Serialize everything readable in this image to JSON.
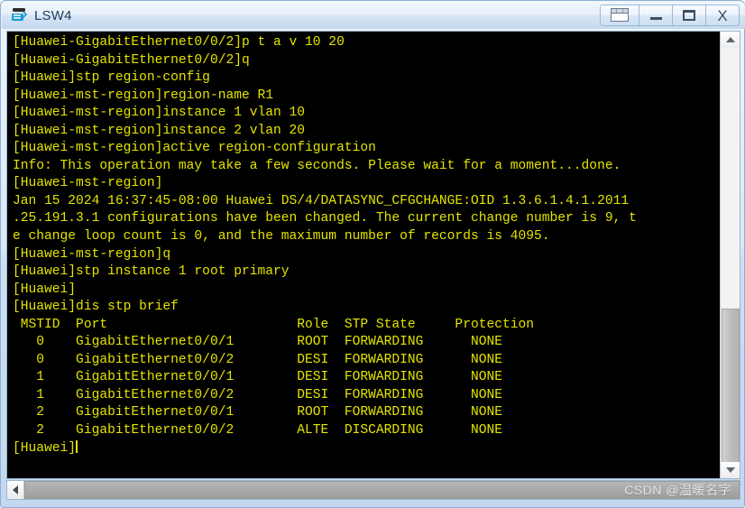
{
  "window": {
    "title": "LSW4",
    "app_icon": "switch-icon",
    "buttons": [
      {
        "name": "restore-all-button",
        "icon": "cascade-windows-icon",
        "label": ""
      },
      {
        "name": "minimize-button",
        "icon": "minimize-icon",
        "label": ""
      },
      {
        "name": "maximize-button",
        "icon": "maximize-icon",
        "label": ""
      },
      {
        "name": "close-button",
        "icon": "close-icon",
        "label": "X"
      }
    ]
  },
  "terminal": {
    "fg_color": "#e4e400",
    "bg_color": "#000000",
    "lines": [
      "[Huawei-GigabitEthernet0/0/2]p t a v 10 20",
      "[Huawei-GigabitEthernet0/0/2]q",
      "[Huawei]stp region-config",
      "[Huawei-mst-region]region-name R1",
      "[Huawei-mst-region]instance 1 vlan 10",
      "[Huawei-mst-region]instance 2 vlan 20",
      "[Huawei-mst-region]active region-configuration",
      "Info: This operation may take a few seconds. Please wait for a moment...done.",
      "[Huawei-mst-region]",
      "Jan 15 2024 16:37:45-08:00 Huawei DS/4/DATASYNC_CFGCHANGE:OID 1.3.6.1.4.1.2011",
      ".25.191.3.1 configurations have been changed. The current change number is 9, t",
      "e change loop count is 0, and the maximum number of records is 4095.",
      "[Huawei-mst-region]q",
      "[Huawei]stp instance 1 root primary",
      "[Huawei]",
      "[Huawei]dis stp brief",
      " MSTID  Port                        Role  STP State     Protection",
      "   0    GigabitEthernet0/0/1        ROOT  FORWARDING      NONE",
      "   0    GigabitEthernet0/0/2        DESI  FORWARDING      NONE",
      "   1    GigabitEthernet0/0/1        DESI  FORWARDING      NONE",
      "   1    GigabitEthernet0/0/2        DESI  FORWARDING      NONE",
      "   2    GigabitEthernet0/0/1        ROOT  FORWARDING      NONE",
      "   2    GigabitEthernet0/0/2        ALTE  DISCARDING      NONE"
    ],
    "prompt": "[Huawei]",
    "stp_table": {
      "headers": [
        "MSTID",
        "Port",
        "Role",
        "STP State",
        "Protection"
      ],
      "rows": [
        [
          "0",
          "GigabitEthernet0/0/1",
          "ROOT",
          "FORWARDING",
          "NONE"
        ],
        [
          "0",
          "GigabitEthernet0/0/2",
          "DESI",
          "FORWARDING",
          "NONE"
        ],
        [
          "1",
          "GigabitEthernet0/0/1",
          "DESI",
          "FORWARDING",
          "NONE"
        ],
        [
          "1",
          "GigabitEthernet0/0/2",
          "DESI",
          "FORWARDING",
          "NONE"
        ],
        [
          "2",
          "GigabitEthernet0/0/1",
          "ROOT",
          "FORWARDING",
          "NONE"
        ],
        [
          "2",
          "GigabitEthernet0/0/2",
          "ALTE",
          "DISCARDING",
          "NONE"
        ]
      ]
    }
  },
  "scrollbars": {
    "vertical": {
      "up_icon": "chevron-up-icon",
      "down_icon": "chevron-down-icon"
    },
    "horizontal": {
      "left_icon": "chevron-left-icon",
      "right_icon": "chevron-right-icon"
    }
  },
  "watermark": "CSDN @温暖名字"
}
